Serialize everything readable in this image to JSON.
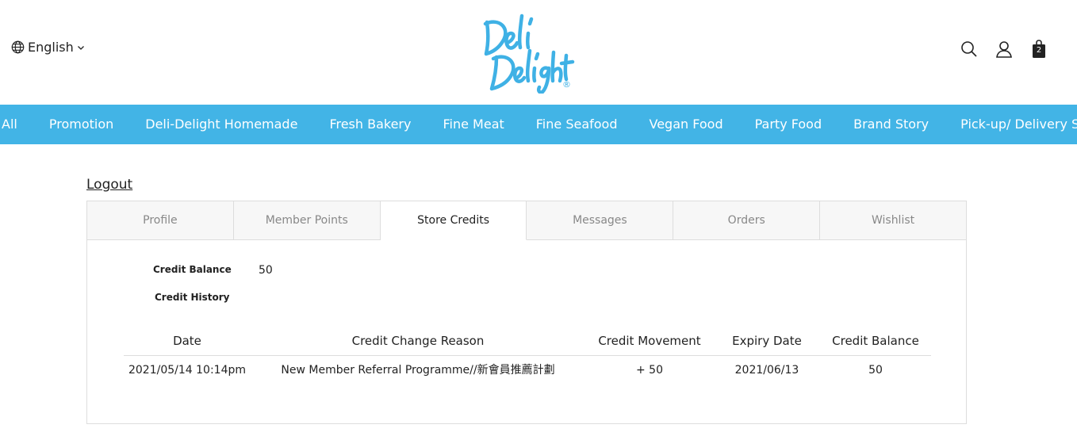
{
  "header": {
    "language": "English",
    "cart_count": "2",
    "icons": [
      "globe-icon",
      "chevron-down-icon",
      "search-icon",
      "user-icon",
      "cart-icon"
    ],
    "brand_color": "#42b4e6"
  },
  "nav": {
    "items": [
      "All",
      "Promotion",
      "Deli-Delight Homemade",
      "Fresh Bakery",
      "Fine Meat",
      "Fine Seafood",
      "Vegan Food",
      "Party Food",
      "Brand Story",
      "Pick-up/ Delivery Service"
    ]
  },
  "account": {
    "logout_label": "Logout",
    "tabs": [
      "Profile",
      "Member Points",
      "Store Credits",
      "Messages",
      "Orders",
      "Wishlist"
    ],
    "active_tab": "Store Credits",
    "credit_balance_label": "Credit Balance",
    "credit_balance_value": "50",
    "credit_history_label": "Credit History",
    "table": {
      "headers": [
        "Date",
        "Credit Change Reason",
        "Credit Movement",
        "Expiry Date",
        "Credit Balance"
      ],
      "rows": [
        [
          "2021/05/14 10:14pm",
          "New Member Referral Programme//新會員推薦計劃",
          "+ 50",
          "2021/06/13",
          "50"
        ]
      ]
    }
  }
}
